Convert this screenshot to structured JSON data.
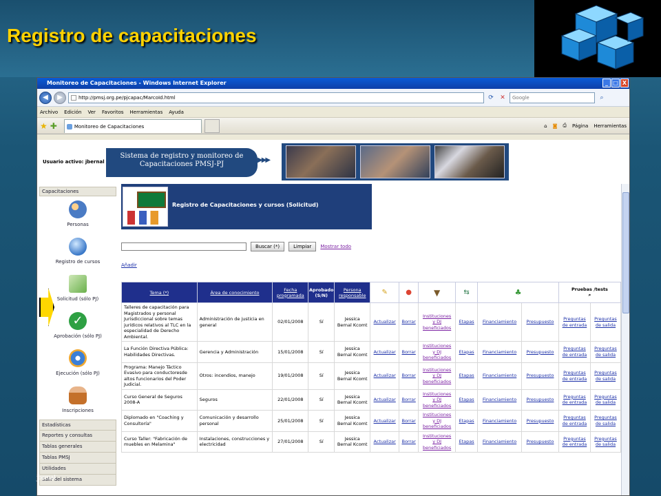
{
  "slide": {
    "title": "Registro de capacitaciones",
    "footer_user": "jbernal"
  },
  "window": {
    "title": "Monitoreo de Capacitaciones - Windows Internet Explorer",
    "btn_min": "_",
    "btn_max": "□",
    "btn_close": "X"
  },
  "addressbar": {
    "url": "http://pmsj.org.pe/pjcapac/MarcoId.html",
    "search_placeholder": "Google"
  },
  "menu": [
    "Archivo",
    "Edición",
    "Ver",
    "Favoritos",
    "Herramientas",
    "Ayuda"
  ],
  "tab": {
    "label": "Monitoreo de Capacitaciones"
  },
  "commands": {
    "page": "Página",
    "tools": "Herramientas"
  },
  "page": {
    "user_label": "Usuario activo: jbernal",
    "system_title": "Sistema de registro y monitoreo de Capacitaciones PMSJ-PJ",
    "header_title": "Registro de Capacitaciones y cursos (Solicitud)",
    "search_btn": "Buscar (*)",
    "clear_btn": "Limpiar",
    "show_all": "Mostrar todo",
    "add": "Añadir"
  },
  "sidebar": {
    "header": "Capacitaciones",
    "items": [
      {
        "label": "Personas",
        "icon": "people-icon",
        "color": "#4a7bc4"
      },
      {
        "label": "Registro de cursos",
        "icon": "globe-icon",
        "color": "#3a78c8"
      },
      {
        "label": "Solicitud (sólo PJ)",
        "icon": "book-icon",
        "color": "#6ab04c"
      },
      {
        "label": "Aprobación (sólo PJ)",
        "icon": "check-icon",
        "color": "#2ea043"
      },
      {
        "label": "Ejecución (sólo PJ)",
        "icon": "gears-icon",
        "color": "#3b7fd6"
      },
      {
        "label": "Inscripciones",
        "icon": "person-icon",
        "color": "#c4702a"
      }
    ],
    "links": [
      "Estadísticas",
      "Reportes y consultas",
      "Tablas generales",
      "Tablas PMSJ",
      "Utilidades",
      "Salir del sistema"
    ]
  },
  "table": {
    "headers": {
      "tema": "Tema (*)",
      "area": "Área de conocimiento",
      "fecha": "Fecha programada",
      "aprobado": "Aprobado (S/N)",
      "persona": "Persona responsable",
      "pruebas": "Pruebas /tests"
    },
    "rows": [
      {
        "tema": "Talleres de capacitación para Magistrados y personal Jurisdiccional sobre temas jurídicos relativos al TLC en la especialidad de Derecho Ambiental.",
        "area": "Administración de justicia en general",
        "fecha": "02/01/2008",
        "aprobado": "Sí",
        "persona": "Jessica Bernal Kcomt"
      },
      {
        "tema": "La Función Directiva Pública: Habilidades Directivas.",
        "area": "Gerencia y Administración",
        "fecha": "15/01/2008",
        "aprobado": "Sí",
        "persona": "Jessica Bernal Kcomt"
      },
      {
        "tema": "Programa: Manejo Táctico Evasivo para conductoresde altos funcionarios del Poder Judicial.",
        "area": "Otros: incendios, manejo",
        "fecha": "19/01/2008",
        "aprobado": "Sí",
        "persona": "Jessica Bernal Kcomt"
      },
      {
        "tema": "Curso General de Seguros 2008-A",
        "area": "Seguros",
        "fecha": "22/01/2008",
        "aprobado": "Sí",
        "persona": "Jessica Bernal Kcomt"
      },
      {
        "tema": "Diplomado en \"Coaching y Consultoría\"",
        "area": "Comunicación y desarrollo personal",
        "fecha": "25/01/2008",
        "aprobado": "Sí",
        "persona": "Jessica Bernal Kcomt"
      },
      {
        "tema": "Curso Taller: \"Fabricación de muebles en Melamina\"",
        "area": "Instalaciones, construcciones y electricidad",
        "fecha": "27/01/2008",
        "aprobado": "Sí",
        "persona": "Jessica Bernal Kcomt"
      }
    ],
    "actions": {
      "actualizar": "Actualizar",
      "borrar": "Borrar",
      "instituciones": "Instituciones y DJ beneficiados",
      "etapas": "Etapas",
      "financiamiento": "Financiamiento",
      "presupuesto": "Presupuesto",
      "entrada": "Preguntas de entrada",
      "salida": "Preguntas de salida"
    }
  },
  "colors": {
    "title": "#ffd200",
    "header_blue": "#1f2f8c",
    "link": "#7a1fa2"
  }
}
